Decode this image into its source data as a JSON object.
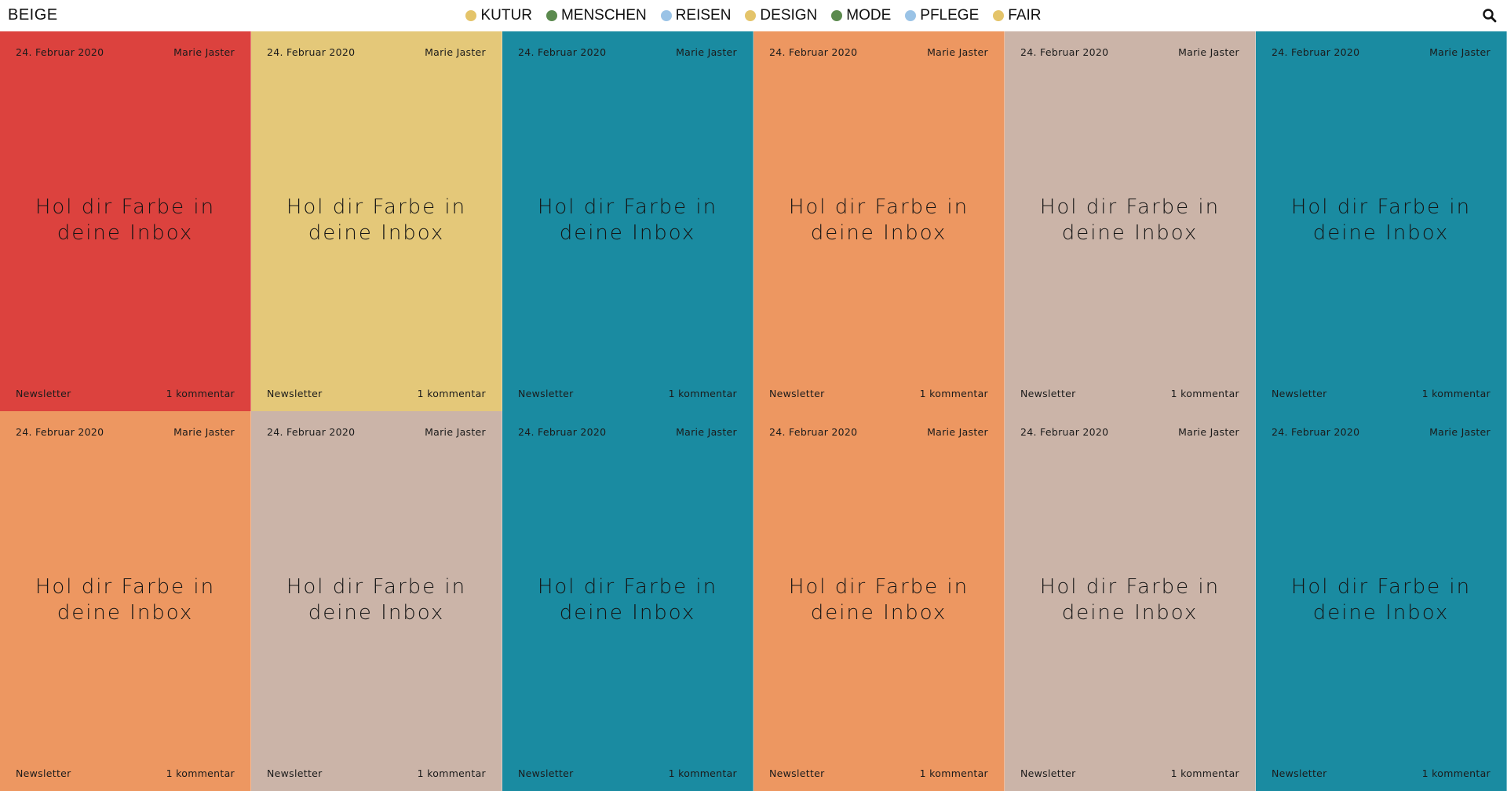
{
  "header": {
    "logo": "BEIGE",
    "nav": [
      {
        "label": "KUTUR",
        "color": "#e4c46a"
      },
      {
        "label": "MENSCHEN",
        "color": "#5b8a4e"
      },
      {
        "label": "REISEN",
        "color": "#9ac3e6"
      },
      {
        "label": "DESIGN",
        "color": "#e4c46a"
      },
      {
        "label": "MODE",
        "color": "#5b8a4e"
      },
      {
        "label": "PFLEGE",
        "color": "#9ac3e6"
      },
      {
        "label": "FAIR",
        "color": "#e4c46a"
      }
    ],
    "search_icon": "search-icon"
  },
  "posts": [
    {
      "color": "#dc423e",
      "date": "24. Februar 2020",
      "author": "Marie Jaster",
      "title": "Hol dir Farbe in deine Inbox",
      "category": "Newsletter",
      "comments": "1 kommentar"
    },
    {
      "color": "#e4c879",
      "date": "24. Februar 2020",
      "author": "Marie Jaster",
      "title": "Hol dir Farbe in deine Inbox",
      "category": "Newsletter",
      "comments": "1 kommentar"
    },
    {
      "color": "#1a8ba1",
      "date": "24. Februar 2020",
      "author": "Marie Jaster",
      "title": "Hol dir Farbe in deine Inbox",
      "category": "Newsletter",
      "comments": "1 kommentar"
    },
    {
      "color": "#ed9761",
      "date": "24. Februar 2020",
      "author": "Marie Jaster",
      "title": "Hol dir Farbe in deine Inbox",
      "category": "Newsletter",
      "comments": "1 kommentar"
    },
    {
      "color": "#cbb4a8",
      "date": "24. Februar 2020",
      "author": "Marie Jaster",
      "title": "Hol dir Farbe in deine Inbox",
      "category": "Newsletter",
      "comments": "1 kommentar"
    },
    {
      "color": "#1a8ba1",
      "date": "24. Februar 2020",
      "author": "Marie Jaster",
      "title": "Hol dir Farbe in deine Inbox",
      "category": "Newsletter",
      "comments": "1 kommentar"
    },
    {
      "color": "#ed9761",
      "date": "24. Februar 2020",
      "author": "Marie Jaster",
      "title": "Hol dir Farbe in deine Inbox",
      "category": "Newsletter",
      "comments": "1 kommentar"
    },
    {
      "color": "#cbb4a8",
      "date": "24. Februar 2020",
      "author": "Marie Jaster",
      "title": "Hol dir Farbe in deine Inbox",
      "category": "Newsletter",
      "comments": "1 kommentar"
    },
    {
      "color": "#1a8ba1",
      "date": "24. Februar 2020",
      "author": "Marie Jaster",
      "title": "Hol dir Farbe in deine Inbox",
      "category": "Newsletter",
      "comments": "1 kommentar"
    },
    {
      "color": "#ed9761",
      "date": "24. Februar 2020",
      "author": "Marie Jaster",
      "title": "Hol dir Farbe in deine Inbox",
      "category": "Newsletter",
      "comments": "1 kommentar"
    },
    {
      "color": "#cbb4a8",
      "date": "24. Februar 2020",
      "author": "Marie Jaster",
      "title": "Hol dir Farbe in deine Inbox",
      "category": "Newsletter",
      "comments": "1 kommentar"
    },
    {
      "color": "#1a8ba1",
      "date": "24. Februar 2020",
      "author": "Marie Jaster",
      "title": "Hol dir Farbe in deine Inbox",
      "category": "Newsletter",
      "comments": "1 kommentar"
    }
  ]
}
